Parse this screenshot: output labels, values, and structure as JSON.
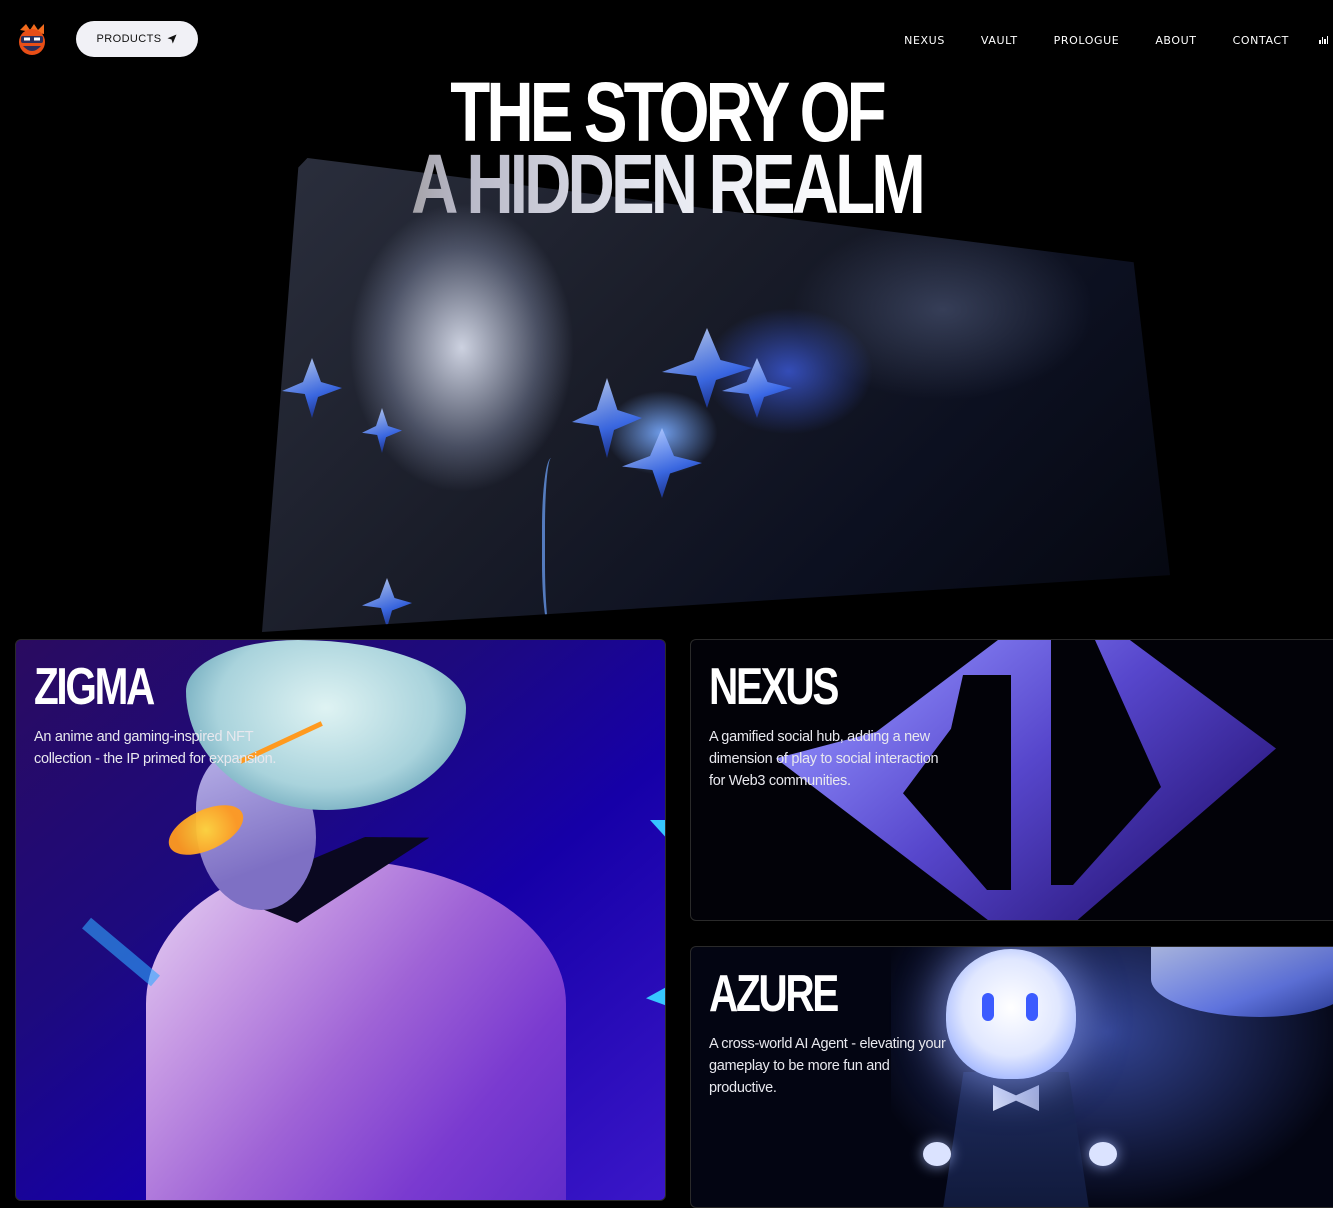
{
  "nav": {
    "logo_icon": "ninja-mascot-logo",
    "products_label": "PRODUCTS",
    "products_icon": "navigation-arrow-icon",
    "links": [
      "NEXUS",
      "VAULT",
      "PROLOGUE",
      "ABOUT",
      "CONTACT"
    ],
    "audio_icon": "audio-bars-icon"
  },
  "hero": {
    "title_line1": "THE STORY OF",
    "title_line2": "A HIDDEN REALM"
  },
  "cards": [
    {
      "title": "ZIGMA",
      "description": "An anime and gaming-inspired NFT collection - the IP primed for expansion."
    },
    {
      "title": "NEXUS",
      "description": "A gamified social hub, adding a new dimension of play to social interaction for Web3 communities."
    },
    {
      "title": "AZURE",
      "description": "A cross-world AI Agent - elevating your gameplay to be more fun and productive."
    }
  ],
  "colors": {
    "background": "#000000",
    "button_bg": "#f1f1f6",
    "zigma_accent": "#1600a8",
    "nexus_accent": "#5b4ad6",
    "azure_accent": "#3b5bff"
  }
}
